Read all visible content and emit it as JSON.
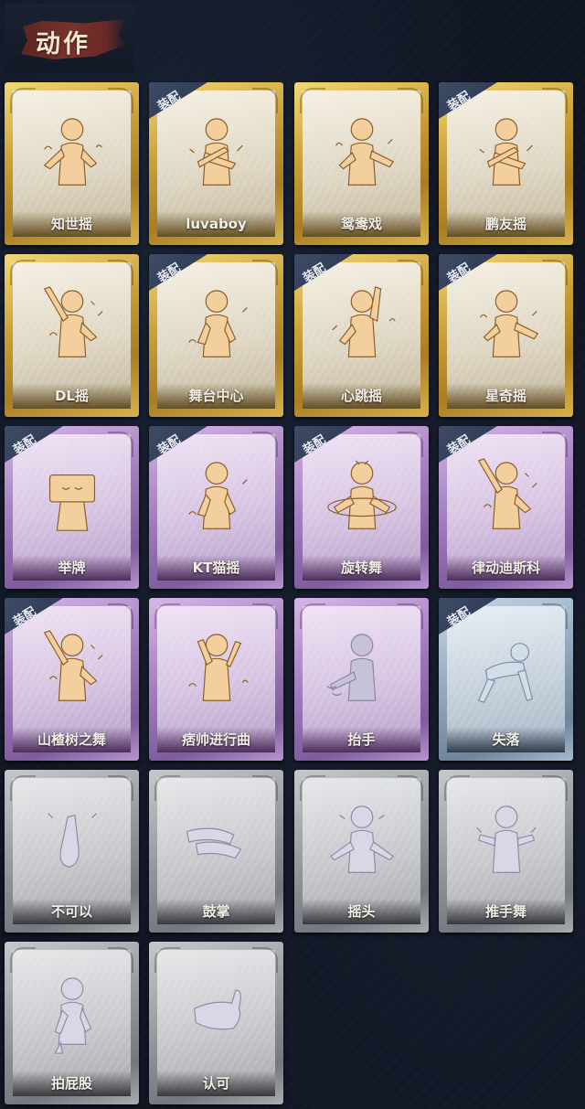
{
  "header": {
    "title": "动作"
  },
  "equipped_badge": "装配",
  "cards": [
    {
      "label": "知世摇",
      "tier": "gold",
      "equipped": false,
      "pose": "wave",
      "icon": "dancer-silhouette-icon"
    },
    {
      "label": "luvaboy",
      "tier": "gold",
      "equipped": true,
      "pose": "cross",
      "icon": "dancer-silhouette-icon"
    },
    {
      "label": "鸳鸯戏",
      "tier": "gold",
      "equipped": false,
      "pose": "punch",
      "icon": "dancer-silhouette-icon"
    },
    {
      "label": "鹏友摇",
      "tier": "gold",
      "equipped": true,
      "pose": "cross",
      "icon": "dancer-silhouette-icon"
    },
    {
      "label": "DL摇",
      "tier": "gold",
      "equipped": false,
      "pose": "armup",
      "icon": "dancer-silhouette-icon"
    },
    {
      "label": "舞台中心",
      "tier": "gold",
      "equipped": true,
      "pose": "hip",
      "icon": "dancer-silhouette-icon"
    },
    {
      "label": "心跳摇",
      "tier": "gold",
      "equipped": true,
      "pose": "reach",
      "icon": "dancer-silhouette-icon"
    },
    {
      "label": "星奇摇",
      "tier": "gold",
      "equipped": true,
      "pose": "punch",
      "icon": "dancer-silhouette-icon"
    },
    {
      "label": "举牌",
      "tier": "purple",
      "equipped": true,
      "pose": "sign",
      "icon": "sign-holder-icon"
    },
    {
      "label": "KT猫摇",
      "tier": "purple",
      "equipped": true,
      "pose": "hip",
      "icon": "dancer-silhouette-icon"
    },
    {
      "label": "旋转舞",
      "tier": "purple",
      "equipped": true,
      "pose": "spin",
      "icon": "spin-dancer-icon"
    },
    {
      "label": "律动迪斯科",
      "tier": "purple",
      "equipped": true,
      "pose": "armup",
      "icon": "disco-dancer-icon"
    },
    {
      "label": "山楂树之舞",
      "tier": "purple",
      "equipped": true,
      "pose": "armup",
      "icon": "dancer-silhouette-icon"
    },
    {
      "label": "痞帅进行曲",
      "tier": "purple",
      "equipped": false,
      "pose": "fists",
      "icon": "dancer-silhouette-icon"
    },
    {
      "label": "抬手",
      "tier": "purple",
      "equipped": false,
      "pose": "raise",
      "faded": true,
      "icon": "raise-hand-icon"
    },
    {
      "label": "失落",
      "tier": "blue",
      "equipped": true,
      "pose": "crawl",
      "icon": "crawling-figure-icon"
    },
    {
      "label": "不可以",
      "tier": "gray",
      "equipped": false,
      "pose": "finger",
      "icon": "finger-wag-icon"
    },
    {
      "label": "鼓掌",
      "tier": "gray",
      "equipped": false,
      "pose": "clap",
      "icon": "clapping-hands-icon"
    },
    {
      "label": "摇头",
      "tier": "gray",
      "equipped": false,
      "pose": "shake",
      "icon": "head-shake-icon"
    },
    {
      "label": "推手舞",
      "tier": "gray",
      "equipped": false,
      "pose": "push",
      "icon": "push-dance-icon"
    },
    {
      "label": "拍屁股",
      "tier": "gray",
      "equipped": false,
      "pose": "slap",
      "icon": "slap-figure-icon"
    },
    {
      "label": "认可",
      "tier": "gray",
      "equipped": false,
      "pose": "thumb",
      "icon": "thumbs-up-icon"
    }
  ]
}
